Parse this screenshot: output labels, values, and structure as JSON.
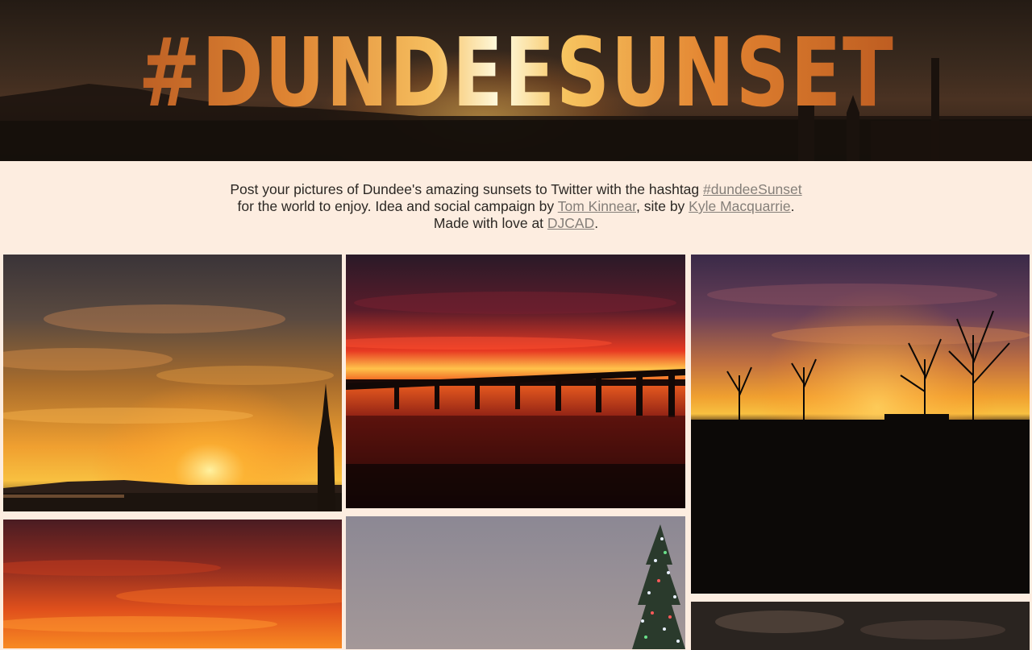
{
  "banner": {
    "title": "#DUNDEESUNSET"
  },
  "intro": {
    "line1": "Post your pictures of Dundee's amazing sunsets to Twitter with the hashtag ",
    "hashtag_link": "#dundeeSunset",
    "line2": "for the world to enjoy. Idea and social campaign by ",
    "campaign_link": "Tom Kinnear",
    "mid": ", site by ",
    "site_link": "Kyle Macquarrie",
    "end": ".",
    "line3": "Made with love at ",
    "djcad_link": "DJCAD",
    "end2": "."
  },
  "colors": {
    "page_background": "#fdede0",
    "banner_background": "#2a1d15",
    "link": "#857f79",
    "text": "#2c2824"
  },
  "photos": [
    {
      "name": "photo-sunset-church-spire",
      "scene": "sunset over the Tay with church spire"
    },
    {
      "name": "photo-sunset-tay-bridge",
      "scene": "red sunset over the Tay rail bridge"
    },
    {
      "name": "photo-sunset-trees-silhouette",
      "scene": "sunset behind bare trees"
    },
    {
      "name": "photo-sunset-red-clouds",
      "scene": "fiery red clouds"
    },
    {
      "name": "photo-sunset-christmas-tree",
      "scene": "grey sky with lit christmas tree"
    },
    {
      "name": "photo-sunset-dark-clouds",
      "scene": "dark cloudy dusk"
    }
  ]
}
